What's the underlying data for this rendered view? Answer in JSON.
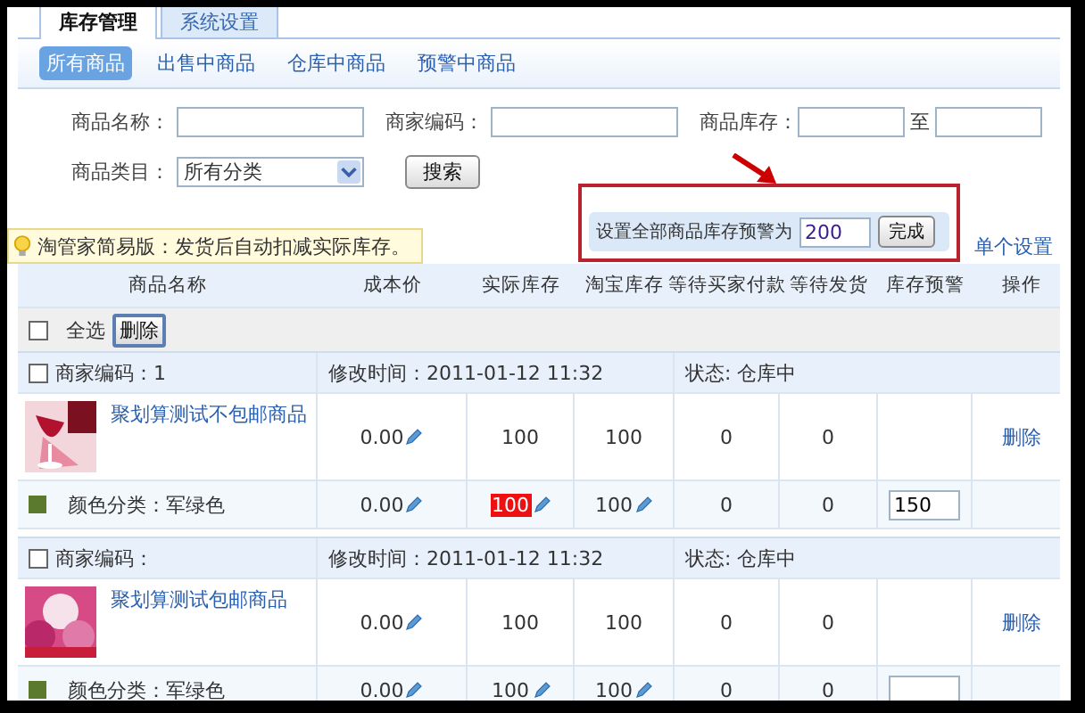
{
  "top_tabs": [
    {
      "label": "库存管理",
      "selected": true
    },
    {
      "label": "系统设置",
      "selected": false
    }
  ],
  "sub_tabs": [
    {
      "label": "所有商品",
      "selected": true
    },
    {
      "label": "出售中商品",
      "selected": false
    },
    {
      "label": "仓库中商品",
      "selected": false
    },
    {
      "label": "预警中商品",
      "selected": false
    }
  ],
  "filters": {
    "name_label": "商品名称：",
    "code_label": "商家编码：",
    "stock_label": "商品库存：",
    "range_sep": "至",
    "category_label": "商品类目：",
    "category_value": "所有分类",
    "search_button": "搜索"
  },
  "bulk_warning": {
    "label": "设置全部商品库存预警为",
    "value": "200",
    "button": "完成",
    "single_link": "单个设置"
  },
  "tip": "淘管家简易版：发货后自动扣减实际库存。",
  "table": {
    "columns": [
      "商品名称",
      "成本价",
      "实际库存",
      "淘宝库存",
      "等待买家付款",
      "等待发货",
      "库存预警",
      "操作"
    ],
    "select_all": {
      "label": "全选",
      "checked": false
    },
    "delete_button": "删除",
    "groups": [
      {
        "checked": false,
        "merchant_code": "商家编码：1",
        "modified": "修改时间：2011-01-12 11:32",
        "status": "状态: 仓库中",
        "product": {
          "kind": "picture",
          "name": "聚划算测试不包邮商品",
          "cost": "0.00",
          "actual": "100",
          "taobao": "100",
          "await_pay": "0",
          "await_ship": "0",
          "action": "删除"
        },
        "sku": {
          "color": "#5b7a2e",
          "label": "颜色分类：军绿色",
          "cost": "0.00",
          "actual": "100",
          "actual_alert": true,
          "taobao": "100",
          "await_pay": "0",
          "await_ship": "0",
          "warning": "150"
        }
      },
      {
        "checked": false,
        "merchant_code": "商家编码：",
        "modified": "修改时间：2011-01-12 11:32",
        "status": "状态: 仓库中",
        "product": {
          "kind": "picture",
          "name": "聚划算测试包邮商品",
          "cost": "0.00",
          "actual": "100",
          "taobao": "100",
          "await_pay": "0",
          "await_ship": "0",
          "action": "删除"
        },
        "sku": {
          "color": "#5b7a2e",
          "label": "颜色分类：军绿色",
          "cost": "0.00",
          "actual": "100",
          "actual_alert": false,
          "taobao": "100",
          "await_pay": "0",
          "await_ship": "0"
        }
      }
    ]
  }
}
